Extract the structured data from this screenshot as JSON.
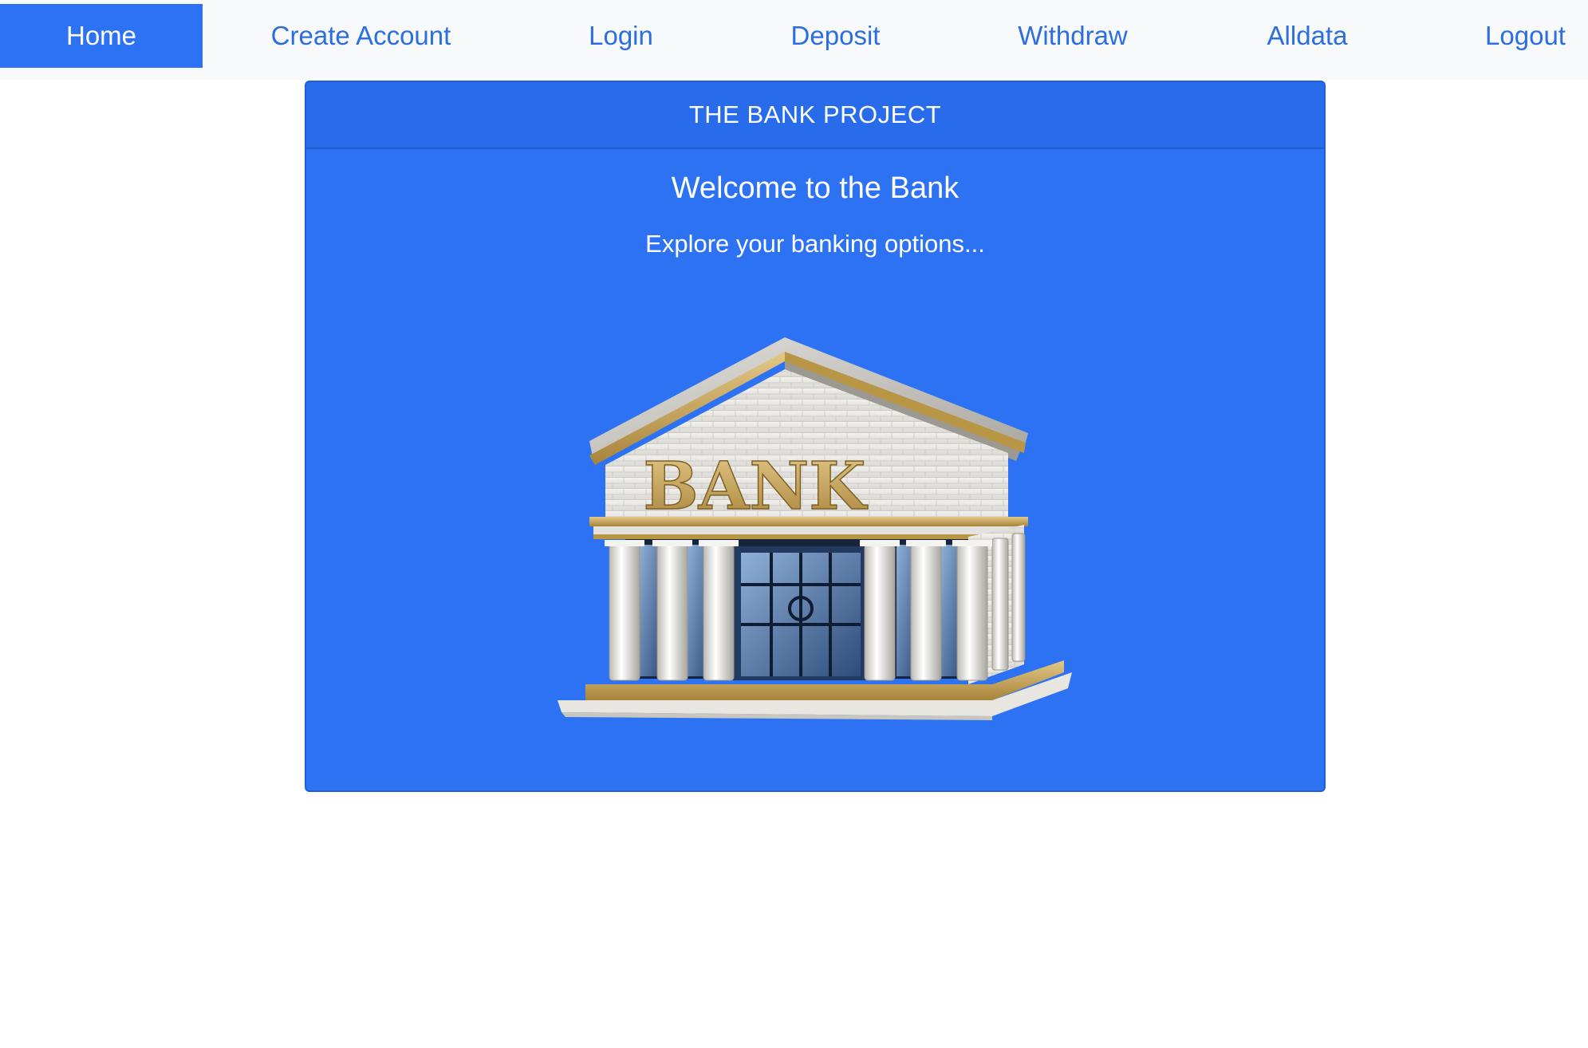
{
  "nav": {
    "items": [
      {
        "label": "Home",
        "active": true
      },
      {
        "label": "Create Account",
        "active": false
      },
      {
        "label": "Login",
        "active": false
      },
      {
        "label": "Deposit",
        "active": false
      },
      {
        "label": "Withdraw",
        "active": false
      },
      {
        "label": "Alldata",
        "active": false
      },
      {
        "label": "Logout",
        "active": false
      }
    ]
  },
  "card": {
    "header": "THE BANK PROJECT",
    "title": "Welcome to the Bank",
    "subtitle": "Explore your banking options...",
    "image_sign_text": "BANK",
    "image_icon": "bank-building-icon"
  },
  "colors": {
    "accent": "#2d72f2",
    "nav_link": "#2b6ee0",
    "card_bg": "#2c72f3",
    "navbar_bg": "#f8f9fa"
  }
}
